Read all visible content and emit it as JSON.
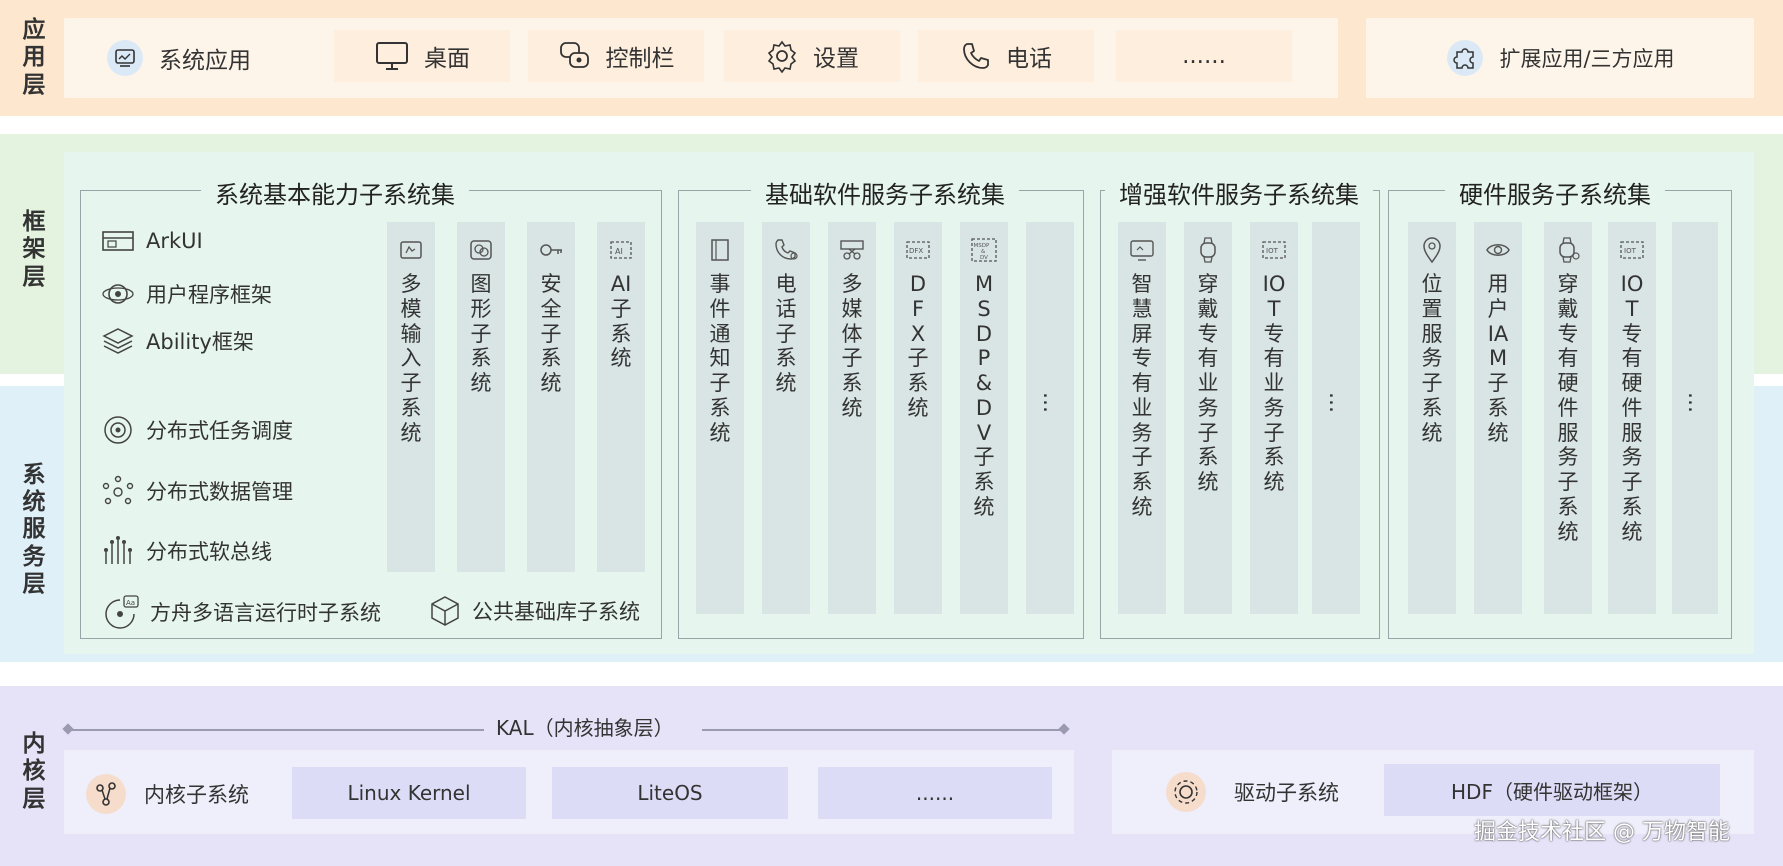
{
  "layers": {
    "app": "应用层",
    "framework": "框架层",
    "system_service": "系统服务层",
    "kernel": "内核层"
  },
  "app_layer": {
    "items": [
      {
        "label": "系统应用",
        "icon": "system-app-icon"
      },
      {
        "label": "桌面",
        "icon": "monitor-icon"
      },
      {
        "label": "控制栏",
        "icon": "control-bar-icon"
      },
      {
        "label": "设置",
        "icon": "gear-icon"
      },
      {
        "label": "电话",
        "icon": "phone-icon"
      },
      {
        "label": "......",
        "icon": ""
      }
    ],
    "extension": {
      "label": "扩展应用/三方应用",
      "icon": "puzzle-icon"
    }
  },
  "groups": {
    "basic": {
      "title": "系统基本能力子系统集",
      "capabilities": [
        {
          "label": "ArkUI",
          "icon": "arkui-icon"
        },
        {
          "label": "用户程序框架",
          "icon": "app-framework-icon"
        },
        {
          "label": "Ability框架",
          "icon": "layers-icon"
        },
        {
          "label": "分布式任务调度",
          "icon": "task-scheduling-icon"
        },
        {
          "label": "分布式数据管理",
          "icon": "data-management-icon"
        },
        {
          "label": "分布式软总线",
          "icon": "softbus-icon"
        },
        {
          "label": "方舟多语言运行时子系统",
          "icon": "runtime-icon"
        },
        {
          "label": "公共基础库子系统",
          "icon": "cube-icon"
        }
      ],
      "columns": [
        {
          "label": "多模输入子系统",
          "icon": "input-icon"
        },
        {
          "label": "图形子系统",
          "icon": "graphics-icon"
        },
        {
          "label": "安全子系统",
          "icon": "key-icon"
        },
        {
          "label": "AI子系统",
          "icon": "ai-icon"
        }
      ]
    },
    "base_software": {
      "title": "基础软件服务子系统集",
      "columns": [
        {
          "label": "事件通知子系统",
          "icon": "notification-icon"
        },
        {
          "label": "电话子系统",
          "icon": "phone-gear-icon"
        },
        {
          "label": "多媒体子系统",
          "icon": "media-icon"
        },
        {
          "label": "DFX子系统",
          "icon": "dfx-icon"
        },
        {
          "label": "MSDP&DV子系统",
          "icon": "msdp-icon"
        },
        {
          "label": "…",
          "icon": ""
        }
      ]
    },
    "enhanced_software": {
      "title": "增强软件服务子系统集",
      "columns": [
        {
          "label": "智慧屏专有业务子系统",
          "icon": "smart-screen-icon"
        },
        {
          "label": "穿戴专有业务子系统",
          "icon": "watch-icon"
        },
        {
          "label": "IOT专有业务子系统",
          "icon": "iot-icon"
        },
        {
          "label": "…",
          "icon": ""
        }
      ]
    },
    "hardware": {
      "title": "硬件服务子系统集",
      "columns": [
        {
          "label": "位置服务子系统",
          "icon": "location-icon"
        },
        {
          "label": "用户IAM子系统",
          "icon": "eye-icon"
        },
        {
          "label": "穿戴专有硬件服务子系统",
          "icon": "watch-gear-icon"
        },
        {
          "label": "IOT专有硬件服务子系统",
          "icon": "iot-icon"
        },
        {
          "label": "…",
          "icon": ""
        }
      ]
    }
  },
  "kernel_layer": {
    "kal": "KAL（内核抽象层）",
    "kernel_subsystem": {
      "label": "内核子系统",
      "icon": "kernel-icon"
    },
    "kernels": [
      "Linux Kernel",
      "LiteOS",
      "......"
    ],
    "driver_subsystem": {
      "label": "驱动子系统",
      "icon": "driver-icon"
    },
    "hdf": "HDF（硬件驱动框架）"
  },
  "watermark": "掘金技术社区 @ 万物智能",
  "colors": {
    "app_band": "#fde8cf",
    "framework_band": "#e3f3df",
    "system_band": "#dff0f9",
    "kernel_band": "#e6e3f8",
    "column_fill": "#d9e4e4",
    "kernel_box": "#dcdcf6"
  }
}
